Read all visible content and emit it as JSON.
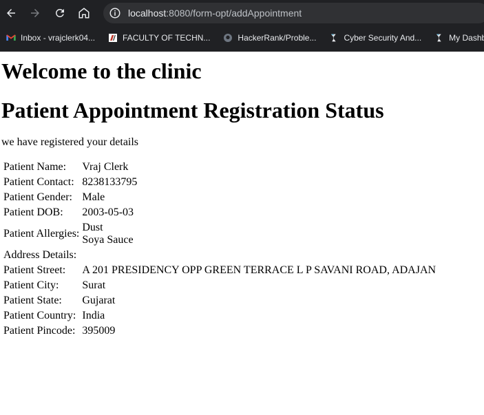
{
  "browser": {
    "url_host": "localhost",
    "url_rest": ":8080/form-opt/addAppointment",
    "bookmarks": [
      {
        "label": "Inbox - vrajclerk04...",
        "icon": "gmail-icon"
      },
      {
        "label": "FACULTY OF TECHN...",
        "icon": "faculty-icon"
      },
      {
        "label": "HackerRank/Proble...",
        "icon": "github-icon"
      },
      {
        "label": "Cyber Security And...",
        "icon": "site-icon"
      },
      {
        "label": "My Dashboa",
        "icon": "site-icon"
      }
    ]
  },
  "page": {
    "heading1": "Welcome to the clinic",
    "heading2": "Patient Appointment Registration Status",
    "message": "we have registered your details",
    "rows": [
      {
        "label": "Patient Name:",
        "value": "Vraj Clerk"
      },
      {
        "label": "Patient Contact:",
        "value": "8238133795"
      },
      {
        "label": "Patient Gender:",
        "value": "Male"
      },
      {
        "label": "Patient DOB:",
        "value": "2003-05-03"
      },
      {
        "label": "Patient Allergies:",
        "value1": "Dust",
        "value2": "Soya Sauce"
      },
      {
        "label": "Address Details:",
        "value": ""
      },
      {
        "label": "Patient Street:",
        "value": "A 201 PRESIDENCY OPP GREEN TERRACE L P SAVANI ROAD, ADAJAN"
      },
      {
        "label": "Patient City:",
        "value": "Surat"
      },
      {
        "label": "Patient State:",
        "value": "Gujarat"
      },
      {
        "label": "Patient Country:",
        "value": "India"
      },
      {
        "label": "Patient Pincode:",
        "value": "395009"
      }
    ]
  }
}
